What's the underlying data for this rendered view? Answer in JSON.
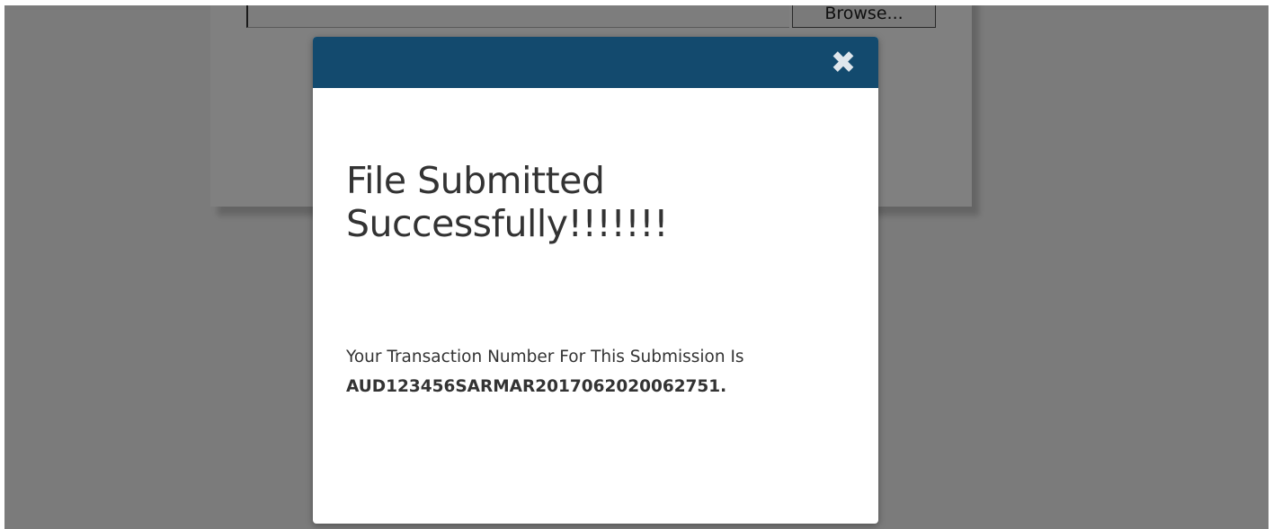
{
  "background": {
    "browse_label": "Browse...",
    "overlay_color": "#7b7b7b"
  },
  "modal": {
    "header_color": "#134a6e",
    "close_icon": "close-icon",
    "close_glyph": "✖",
    "title": "File Submitted Successfully!!!!!!!",
    "message_prefix": "Your Transaction Number For This Submission Is",
    "transaction_number": "AUD123456SARMAR2017062020062751."
  }
}
